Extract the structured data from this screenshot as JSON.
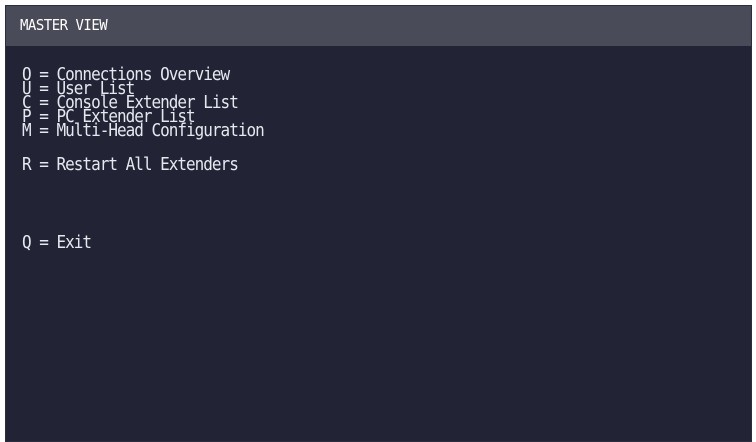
{
  "window": {
    "title": "MASTER VIEW"
  },
  "menu": {
    "items": [
      {
        "key": "O",
        "label": "Connections Overview",
        "text": "O = Connections Overview"
      },
      {
        "key": "U",
        "label": "User List",
        "text": "U = User List"
      },
      {
        "key": "C",
        "label": "Console Extender List",
        "text": "C = Console Extender List"
      },
      {
        "key": "P",
        "label": "PC Extender List",
        "text": "P = PC Extender List"
      },
      {
        "key": "M",
        "label": "Multi-Head Configuration",
        "text": "M = Multi-Head Configuration"
      },
      {
        "key": "R",
        "label": "Restart All Extenders",
        "text": "R = Restart All Extenders"
      },
      {
        "key": "Q",
        "label": "Exit",
        "text": "Q = Exit"
      }
    ]
  },
  "colors": {
    "background": "#222436",
    "titlebar": "#4a4b58",
    "text": "#e6e8f0"
  }
}
